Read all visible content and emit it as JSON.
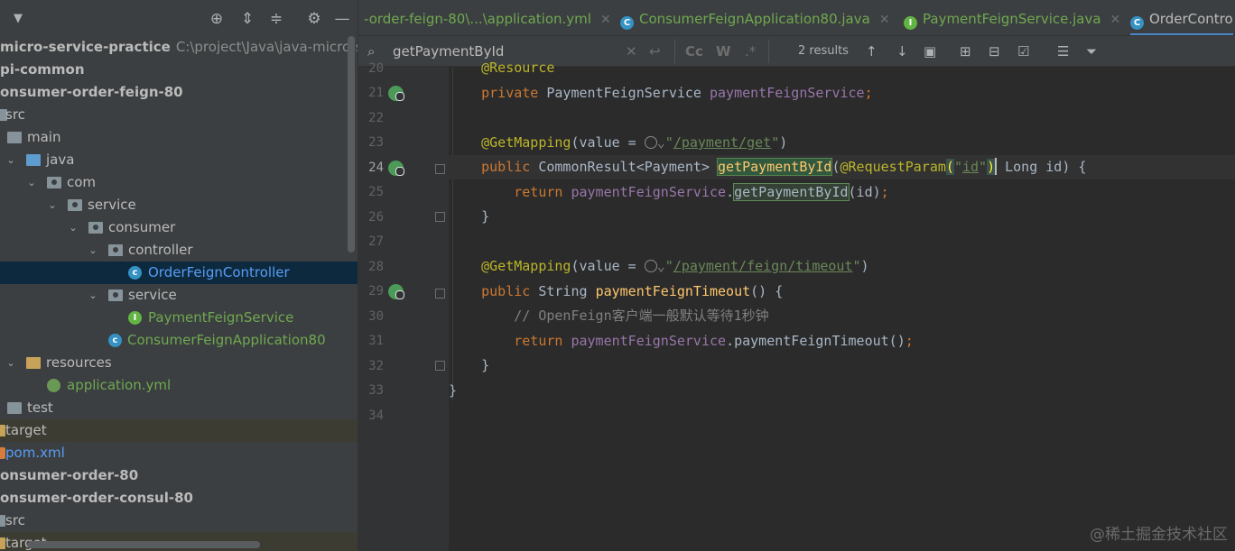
{
  "project": {
    "tree": [
      {
        "label": "micro-service-practice",
        "path": "C:\\project\\Java\\java-micro-ser",
        "bold": true
      },
      {
        "label": "pi-common",
        "bold": true
      },
      {
        "label": "onsumer-order-feign-80",
        "bold": true
      },
      {
        "label": "src"
      },
      {
        "label": "main"
      },
      {
        "label": "java"
      },
      {
        "label": "com"
      },
      {
        "label": "service"
      },
      {
        "label": "consumer"
      },
      {
        "label": "controller"
      },
      {
        "label": "OrderFeignController"
      },
      {
        "label": "service"
      },
      {
        "label": "PaymentFeignService"
      },
      {
        "label": "ConsumerFeignApplication80"
      },
      {
        "label": "resources"
      },
      {
        "label": "application.yml"
      },
      {
        "label": "test"
      },
      {
        "label": "target"
      },
      {
        "label": "pom.xml"
      },
      {
        "label": "onsumer-order-80",
        "bold": true
      },
      {
        "label": "onsumer-order-consul-80",
        "bold": true
      },
      {
        "label": "src"
      },
      {
        "label": "target"
      }
    ]
  },
  "tabs": [
    {
      "label": "-order-feign-80\\...\\application.yml"
    },
    {
      "label": "ConsumerFeignApplication80.java",
      "icon_letter": "C"
    },
    {
      "label": "PaymentFeignService.java",
      "icon_letter": "I"
    },
    {
      "label": "OrderContro",
      "icon_letter": "C"
    }
  ],
  "find": {
    "query": "getPaymentById",
    "case_label": "Cc",
    "word_label": "W",
    "regex_label": ".*",
    "results": "2 results"
  },
  "editor": {
    "lines": [
      {
        "n": "20",
        "t": "    @Resource"
      },
      {
        "n": "21",
        "t": "    private PaymentFeignService paymentFeignService;"
      },
      {
        "n": "22",
        "t": ""
      },
      {
        "n": "23",
        "t": "    @GetMapping(value = \"/payment/get\")"
      },
      {
        "n": "24",
        "t": "    public CommonResult<Payment> getPaymentById(@RequestParam(\"id\") Long id) {"
      },
      {
        "n": "25",
        "t": "        return paymentFeignService.getPaymentById(id);"
      },
      {
        "n": "26",
        "t": "    }"
      },
      {
        "n": "27",
        "t": ""
      },
      {
        "n": "28",
        "t": "    @GetMapping(value = \"/payment/feign/timeout\")"
      },
      {
        "n": "29",
        "t": "    public String paymentFeignTimeout() {"
      },
      {
        "n": "30",
        "t": "        // OpenFeign客户端一般默认等待1秒钟"
      },
      {
        "n": "31",
        "t": "        return paymentFeignService.paymentFeignTimeout();"
      },
      {
        "n": "32",
        "t": "    }"
      },
      {
        "n": "33",
        "t": "}"
      },
      {
        "n": "34",
        "t": ""
      }
    ]
  },
  "watermark": "@稀土掘金技术社区",
  "colors": {
    "keyword": "#cc7832",
    "annotation": "#bbb529",
    "string": "#6a8759",
    "field": "#9876aa",
    "method": "#ffc66d",
    "selection": "#0d293e"
  }
}
